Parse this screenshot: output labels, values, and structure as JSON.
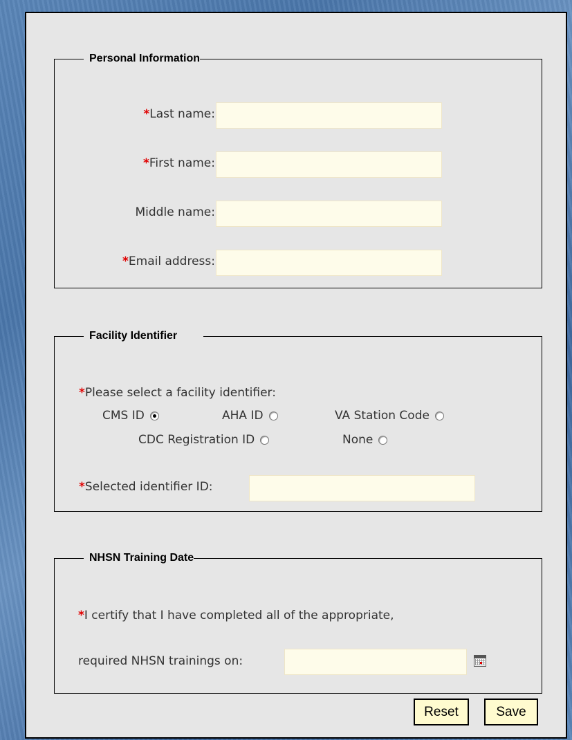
{
  "personal": {
    "legend": "Personal Information",
    "last_name_label": "Last name:",
    "first_name_label": "First name:",
    "middle_name_label": "Middle name:",
    "email_label": "Email address:",
    "last_name_value": "",
    "first_name_value": "",
    "middle_name_value": "",
    "email_value": ""
  },
  "facility": {
    "legend": "Facility Identifier",
    "prompt": "Please select a facility identifier:",
    "options": [
      "CMS ID",
      "AHA ID",
      "VA Station Code",
      "CDC Registration ID",
      "None"
    ],
    "selected": "CMS ID",
    "selected_id_label": "Selected identifier ID:",
    "selected_id_value": ""
  },
  "training": {
    "legend": "NHSN Training Date",
    "line1": "I certify that I have completed all of the appropriate,",
    "line2": "required NHSN trainings on:",
    "date_value": ""
  },
  "buttons": {
    "reset": "Reset",
    "save": "Save"
  },
  "required_marker": "*",
  "colors": {
    "required": "#e00000",
    "input_bg": "#fefcea",
    "panel_bg": "#e6e6e6",
    "button_bg": "#fffbcf"
  },
  "icons": {
    "calendar": "calendar-icon"
  }
}
